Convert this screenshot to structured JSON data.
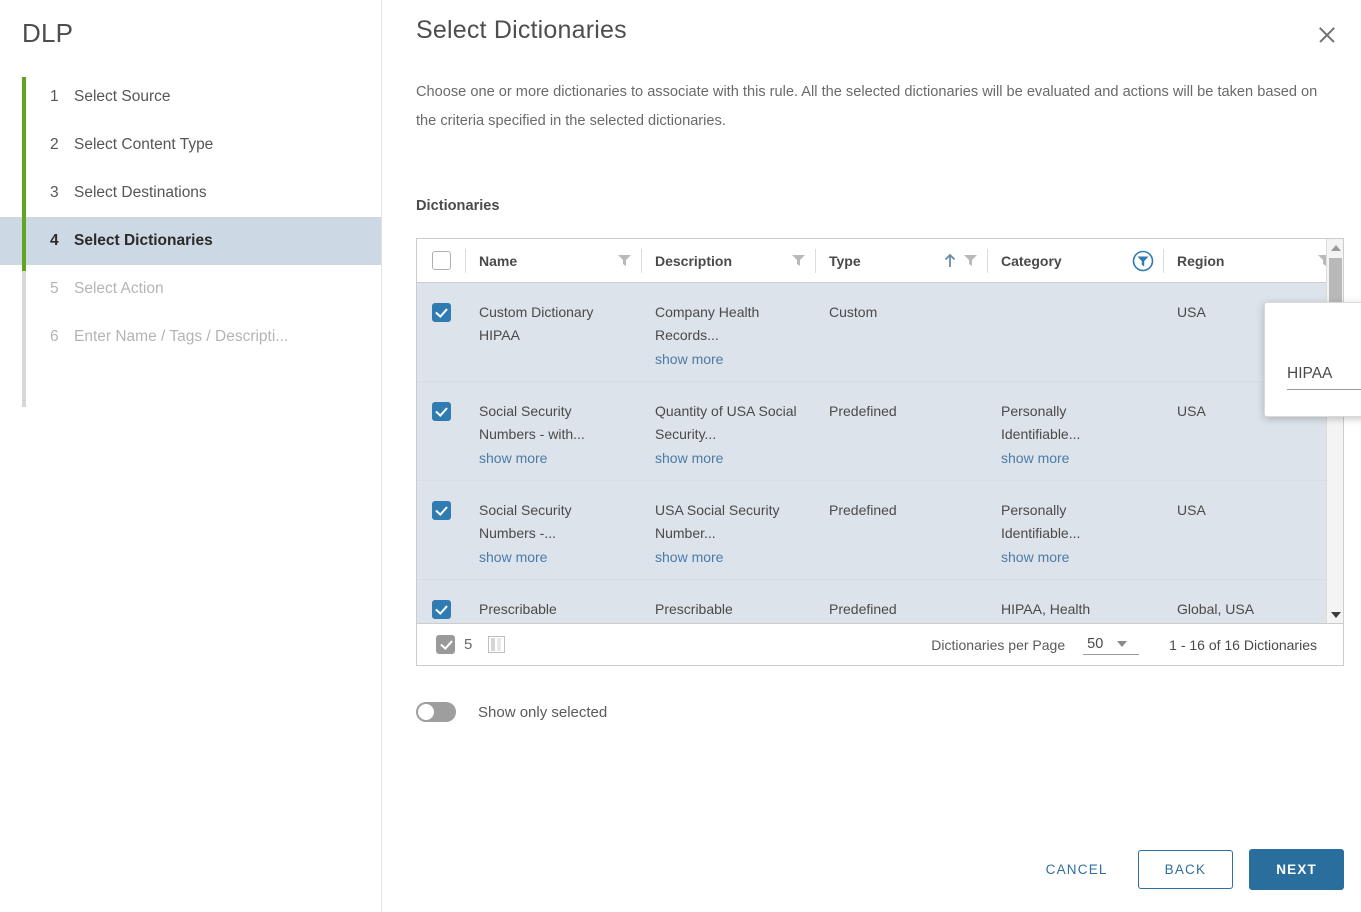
{
  "sidebar": {
    "app_title": "DLP",
    "steps": [
      {
        "num": "1",
        "label": "Select Source",
        "state": "done"
      },
      {
        "num": "2",
        "label": "Select Content Type",
        "state": "done"
      },
      {
        "num": "3",
        "label": "Select Destinations",
        "state": "done"
      },
      {
        "num": "4",
        "label": "Select Dictionaries",
        "state": "active"
      },
      {
        "num": "5",
        "label": "Select Action",
        "state": "disabled"
      },
      {
        "num": "6",
        "label": "Enter Name / Tags / Descripti...",
        "state": "disabled"
      }
    ]
  },
  "panel": {
    "title": "Select Dictionaries",
    "close_icon": "close-icon",
    "description": "Choose one or more dictionaries to associate with this rule. All the selected dictionaries will be evaluated and actions will be taken based on the criteria specified in the selected dictionaries.",
    "section_label": "Dictionaries"
  },
  "table": {
    "header_checkbox_checked": false,
    "columns": [
      {
        "label": "Name",
        "filter": "funnel-icon",
        "sort": null
      },
      {
        "label": "Description",
        "filter": "funnel-icon",
        "sort": null
      },
      {
        "label": "Type",
        "filter": "funnel-icon",
        "sort": "ascending"
      },
      {
        "label": "Category",
        "filter": "funnel-active-icon",
        "sort": null
      },
      {
        "label": "Region",
        "filter": "funnel-icon",
        "sort": null
      }
    ],
    "show_more_label": "show more",
    "rows": [
      {
        "checked": true,
        "name": "Custom Dictionary HIPAA",
        "name_more": true,
        "description": "Company Health Records...",
        "desc_more": true,
        "type": "Custom",
        "category": "",
        "cat_more": false,
        "region": "USA"
      },
      {
        "checked": true,
        "name": "Social Security Numbers - with...",
        "name_more": true,
        "description": "Quantity of USA Social Security...",
        "desc_more": true,
        "type": "Predefined",
        "category": "Personally Identifiable...",
        "cat_more": true,
        "region": "USA"
      },
      {
        "checked": true,
        "name": "Social Security Numbers -...",
        "name_more": true,
        "description": "USA Social Security Number...",
        "desc_more": true,
        "type": "Predefined",
        "category": "Personally Identifiable...",
        "cat_more": true,
        "region": "USA"
      },
      {
        "checked": true,
        "name": "Prescribable",
        "name_more": false,
        "description": "Prescribable",
        "desc_more": false,
        "type": "Predefined",
        "category": "HIPAA, Health",
        "cat_more": false,
        "region": "Global, USA"
      }
    ],
    "footer": {
      "selected_checkbox_checked": true,
      "selected_count": "5",
      "columns_icon": "columns-toggle-icon",
      "per_page_label": "Dictionaries per Page",
      "per_page_value": "50",
      "range_label": "1 - 16 of 16 Dictionaries"
    }
  },
  "filter_popup": {
    "close_icon": "close-icon",
    "value": "HIPAA",
    "placeholder": ""
  },
  "toggle": {
    "label": "Show only selected",
    "on": false
  },
  "actions": {
    "cancel": "CANCEL",
    "back": "BACK",
    "next": "NEXT"
  },
  "colors": {
    "step_done": "#62a420",
    "step_active_bg": "#ccd8e4",
    "accent": "#2a6e9e",
    "row_selected_bg": "#dce3ea",
    "link": "#4c7ba6"
  }
}
